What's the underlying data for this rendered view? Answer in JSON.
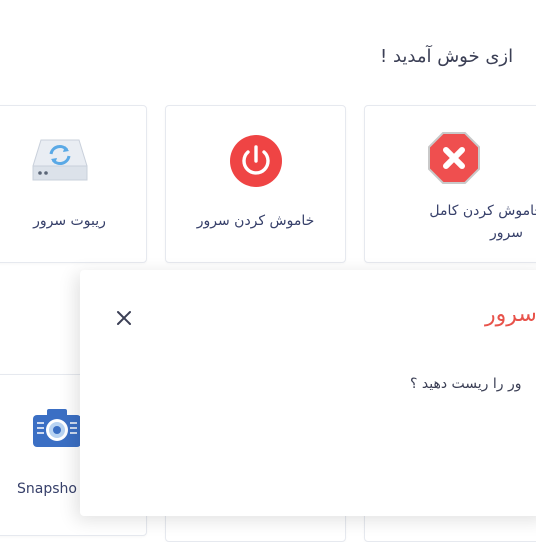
{
  "header": {
    "welcome_text": "ازی خوش آمدید !"
  },
  "cards": {
    "reboot": {
      "label": "ریبوت سرور",
      "icon": "server-reboot-icon"
    },
    "shutdown": {
      "label": "خاموش کردن سرور",
      "icon": "power-icon"
    },
    "full_shutdown": {
      "label_line1": "خاموش کردن کامل",
      "label_line2": "سرور",
      "icon": "stop-x-icon"
    },
    "snapshot": {
      "label": "Snapsho",
      "icon": "camera-icon"
    }
  },
  "modal": {
    "title": "سرور",
    "body": "ور را ریست دهید ؟",
    "close_icon": "close-icon"
  },
  "colors": {
    "power_red": "#ef4444",
    "stop_red": "#ef4f4f",
    "title_red": "#e8534b",
    "text_dark": "#37406a",
    "camera_blue": "#3b6fc4"
  }
}
